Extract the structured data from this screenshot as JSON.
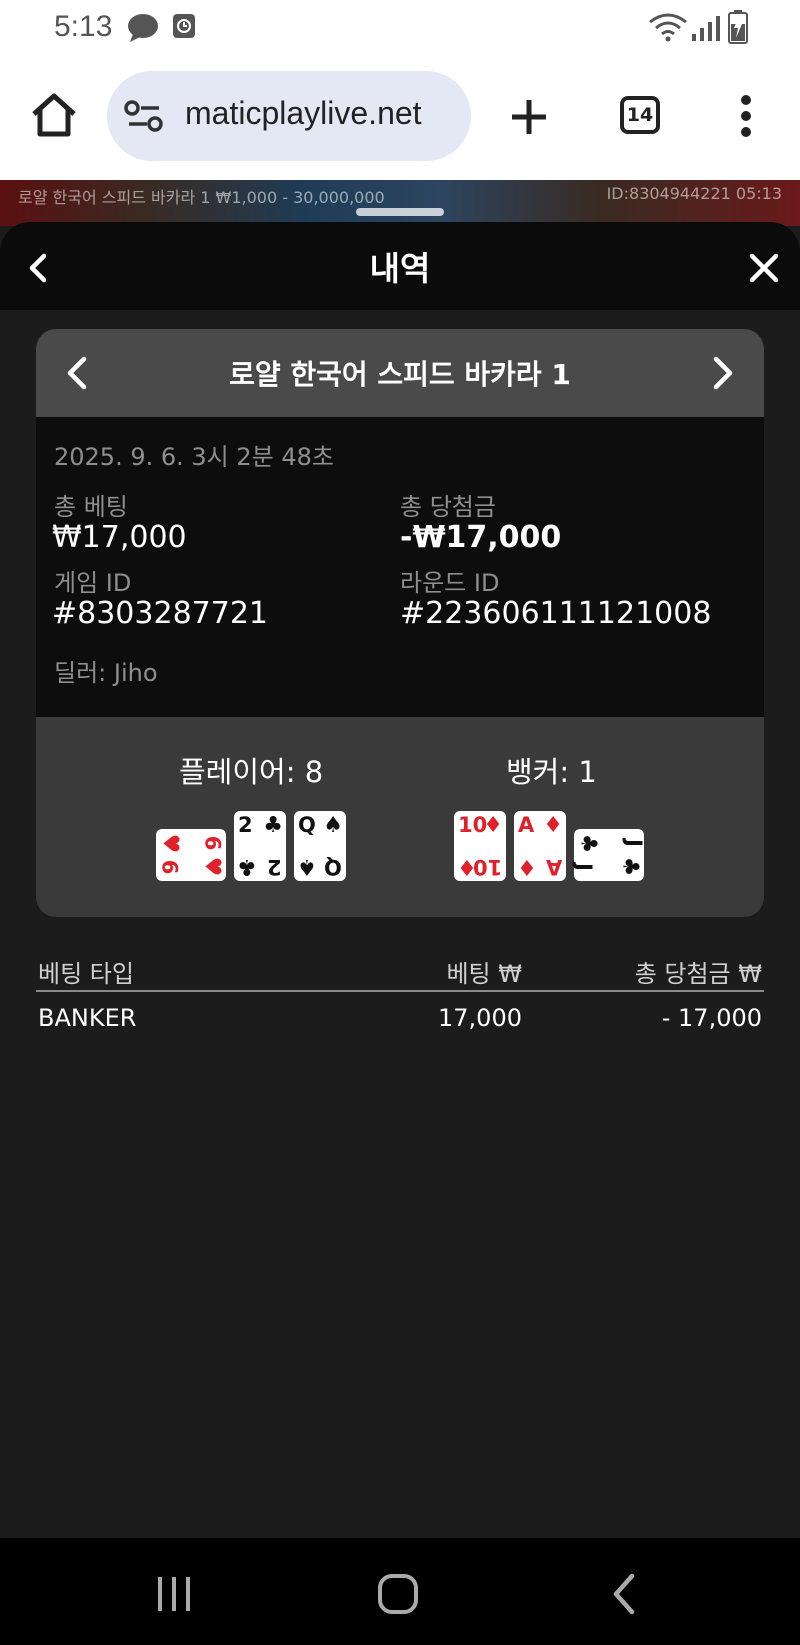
{
  "status_bar": {
    "time": "5:13"
  },
  "browser": {
    "url": "maticplaylive.net",
    "tab_count": "14"
  },
  "game_strip": {
    "info": "로얄 한국어 스피드 바카라 1 ₩1,000 - 30,000,000",
    "id": "ID:8304944221 05:13"
  },
  "sheet": {
    "title": "내역"
  },
  "record": {
    "game_name": "로얄 한국어 스피드 바카라 1",
    "date": "2025. 9. 6. 3시 2분 48초",
    "total_bet_label": "총 베팅",
    "total_bet_value": "₩17,000",
    "total_win_label": "총 당첨금",
    "total_win_value": "-₩17,000",
    "game_id_label": "게임 ID",
    "game_id_value": "#8303287721",
    "round_id_label": "라운드 ID",
    "round_id_value": "#223606111121008",
    "dealer": "딜러: Jiho"
  },
  "hands": {
    "player_label": "플레이어: 8",
    "banker_label": "뱅커: 1",
    "player_cards": [
      {
        "rank": "6",
        "suit": "♥",
        "color": "#e0202a",
        "sideways": true
      },
      {
        "rank": "2",
        "suit": "♣",
        "color": "#111111",
        "sideways": false
      },
      {
        "rank": "Q",
        "suit": "♠",
        "color": "#111111",
        "sideways": false
      }
    ],
    "banker_cards": [
      {
        "rank": "10",
        "suit": "♦",
        "color": "#e0202a",
        "sideways": false
      },
      {
        "rank": "A",
        "suit": "♦",
        "color": "#e0202a",
        "sideways": false
      },
      {
        "rank": "J",
        "suit": "♣",
        "color": "#111111",
        "sideways": true
      }
    ]
  },
  "bets_table": {
    "headers": [
      "베팅 타입",
      "베팅 ₩",
      "총 당첨금 ₩"
    ],
    "rows": [
      {
        "type": "BANKER",
        "bet": "17,000",
        "win": "- 17,000"
      }
    ]
  }
}
